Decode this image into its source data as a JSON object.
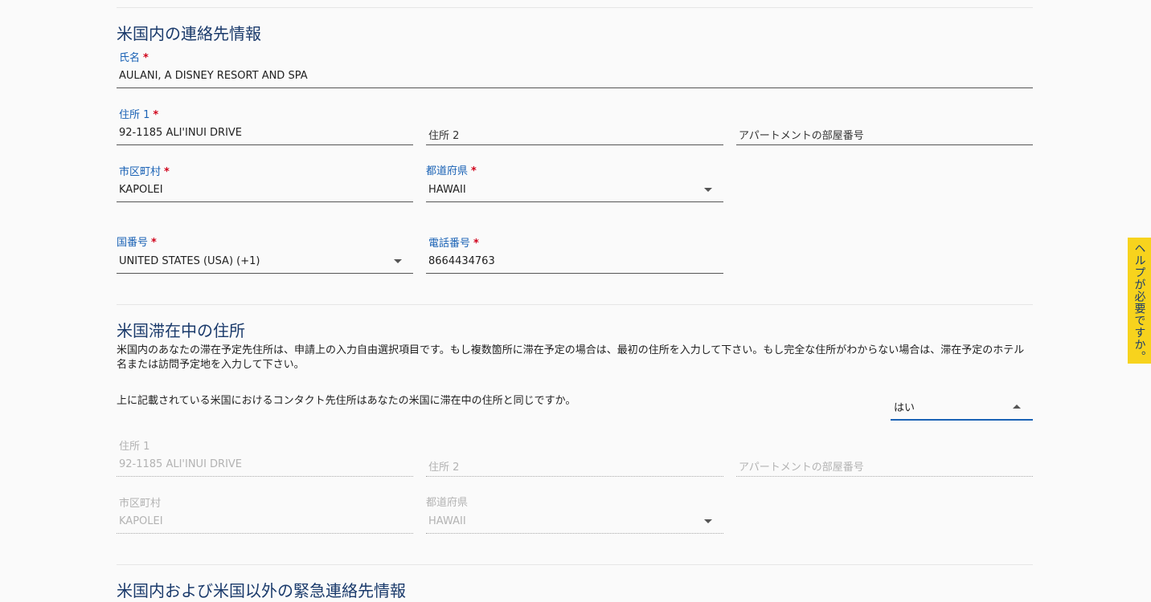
{
  "us_contact": {
    "title": "米国内の連絡先情報",
    "name_label": "氏名",
    "name_value": "AULANI, A DISNEY RESORT AND SPA",
    "address1_label": "住所 1",
    "address1_value": "92-1185 ALI'INUI DRIVE",
    "address2_placeholder": "住所 2",
    "apartment_placeholder": "アパートメントの部屋番号",
    "city_label": "市区町村",
    "city_value": "KAPOLEI",
    "state_label": "都道府県",
    "state_value": "HAWAII",
    "country_code_label": "国番号",
    "country_code_value": "UNITED STATES (USA) (+1)",
    "phone_label": "電話番号",
    "phone_value": "8664434763",
    "required_mark": "*"
  },
  "us_stay": {
    "title": "米国滞在中の住所",
    "description": "米国内のあなたの滞在予定先住所は、申請上の入力自由選択項目です。もし複数箇所に滞在予定の場合は、最初の住所を入力して下さい。もし完全な住所がわからない場合は、滞在予定のホテル名または訪問予定地を入力して下さい。",
    "same_question": "上に記載されている米国におけるコンタクト先住所はあなたの米国に滞在中の住所と同じですか。",
    "same_answer": "はい",
    "address1_label": "住所 1",
    "address1_value": "92-1185 ALI'INUI DRIVE",
    "address2_placeholder": "住所 2",
    "apartment_placeholder": "アパートメントの部屋番号",
    "city_label": "市区町村",
    "city_value": "KAPOLEI",
    "state_label": "都道府県",
    "state_value": "HAWAII"
  },
  "emergency": {
    "title": "米国内および米国以外の緊急連絡先情報"
  },
  "help_tab": {
    "label": "ヘルプが必要ですか。",
    "color": "#f7d31d"
  }
}
